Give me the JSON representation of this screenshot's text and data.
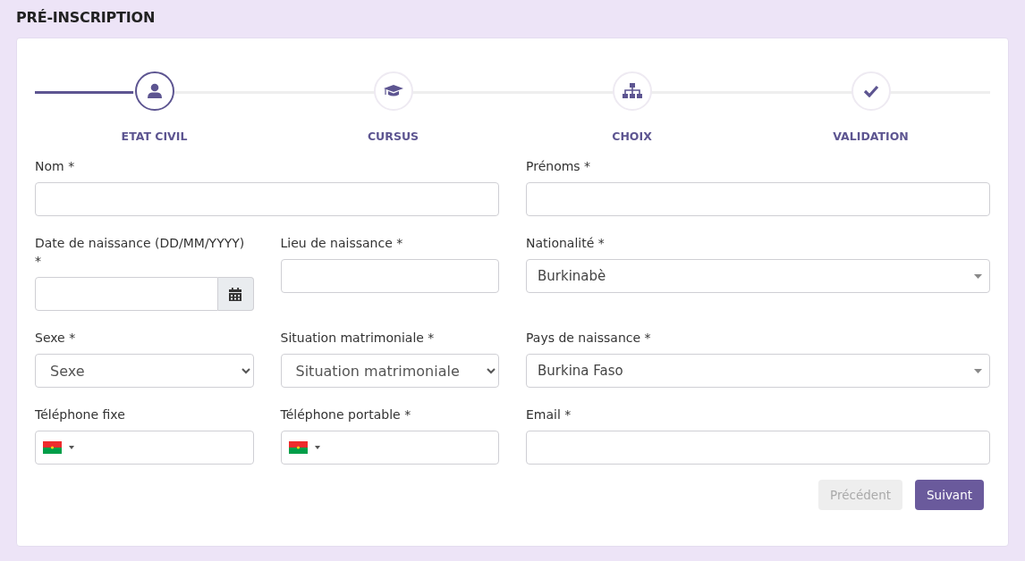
{
  "page_title": "PRÉ-INSCRIPTION",
  "steps": [
    {
      "label": "ETAT CIVIL",
      "kind": "person",
      "selected": true
    },
    {
      "label": "CURSUS",
      "kind": "studies",
      "selected": false
    },
    {
      "label": "CHOIX",
      "kind": "choice",
      "selected": false
    },
    {
      "label": "VALIDATION",
      "kind": "validation",
      "selected": false
    }
  ],
  "form_rows": [
    [
      {
        "kind": "text",
        "label": "Nom *"
      },
      {
        "kind": "text",
        "label": "Prénoms *"
      }
    ],
    [
      {
        "kind": "date",
        "label": "Date de naissance (DD/MM/YYYY) *"
      },
      {
        "kind": "text",
        "label": "Lieu de naissance *"
      },
      {
        "kind": "combo",
        "label": "Nationalité *",
        "value": "Burkinabè"
      }
    ],
    [
      {
        "kind": "select",
        "label": "Sexe *",
        "value": "Sexe"
      },
      {
        "kind": "select",
        "label": "Situation matrimoniale *",
        "value": "Situation matrimoniale"
      },
      {
        "kind": "combo",
        "label": "Pays de naissance *",
        "value": "Burkina Faso"
      }
    ],
    [
      {
        "kind": "phone",
        "label": "Téléphone fixe"
      },
      {
        "kind": "phone",
        "label": "Téléphone portable *"
      },
      {
        "kind": "text",
        "label": "Email *"
      }
    ]
  ],
  "buttons": [
    {
      "label": "Précédent",
      "disabled": true
    },
    {
      "label": "Suivant",
      "disabled": false
    }
  ]
}
